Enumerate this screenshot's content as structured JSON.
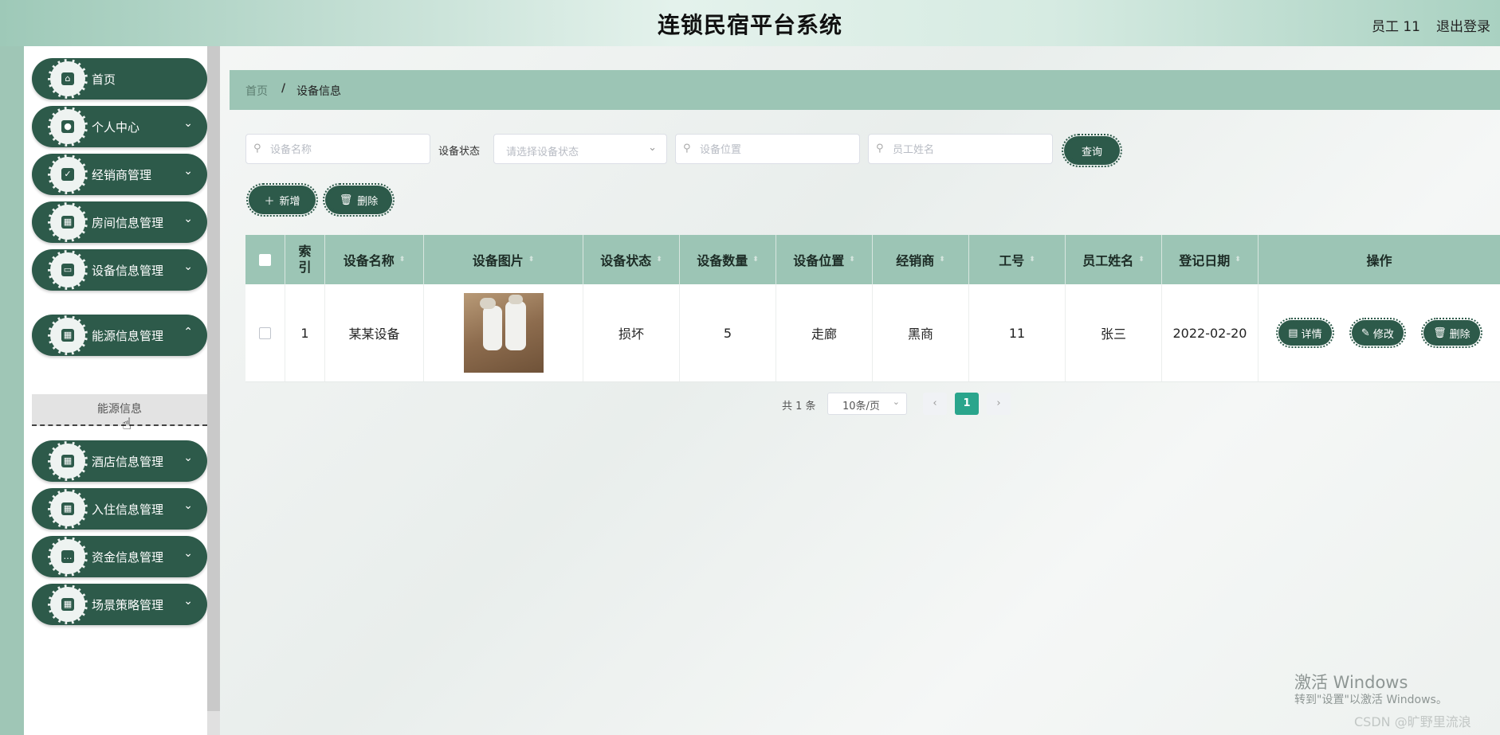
{
  "header": {
    "title": "连锁民宿平台系统",
    "user": "员工 11",
    "logout": "退出登录"
  },
  "sidebar": {
    "items": [
      {
        "label": "首页",
        "icon": "home-icon",
        "has_chevron": false
      },
      {
        "label": "个人中心",
        "icon": "user-icon",
        "has_chevron": true
      },
      {
        "label": "经销商管理",
        "icon": "clipboard-icon",
        "has_chevron": true
      },
      {
        "label": "房间信息管理",
        "icon": "grid-icon",
        "has_chevron": true
      },
      {
        "label": "设备信息管理",
        "icon": "device-icon",
        "has_chevron": true
      },
      {
        "label": "能源信息管理",
        "icon": "grid-icon",
        "has_chevron": true
      },
      {
        "label": "酒店信息管理",
        "icon": "grid-icon",
        "has_chevron": true
      },
      {
        "label": "入住信息管理",
        "icon": "grid-icon",
        "has_chevron": true
      },
      {
        "label": "资金信息管理",
        "icon": "chat-icon",
        "has_chevron": true
      },
      {
        "label": "场景策略管理",
        "icon": "grid-icon",
        "has_chevron": true
      }
    ],
    "submenu": {
      "label": "能源信息"
    }
  },
  "breadcrumb": {
    "home": "首页",
    "separator": "/",
    "current": "设备信息"
  },
  "search": {
    "name_placeholder": "设备名称",
    "status_label": "设备状态",
    "status_placeholder": "请选择设备状态",
    "location_placeholder": "设备位置",
    "employee_placeholder": "员工姓名",
    "query_label": "查询"
  },
  "toolbar": {
    "add_label": "新增",
    "delete_label": "删除"
  },
  "table": {
    "columns": [
      "索引",
      "设备名称",
      "设备图片",
      "设备状态",
      "设备数量",
      "设备位置",
      "经销商",
      "工号",
      "员工姓名",
      "登记日期",
      "操作"
    ],
    "rows": [
      {
        "index": "1",
        "name": "某某设备",
        "status": "损坏",
        "quantity": "5",
        "location": "走廊",
        "dealer": "黑商",
        "employee_no": "11",
        "employee_name": "张三",
        "date": "2022-02-20",
        "actions": {
          "detail": "详情",
          "edit": "修改",
          "delete": "删除"
        }
      }
    ]
  },
  "pagination": {
    "total": "共 1 条",
    "page_size": "10条/页",
    "current_page": "1"
  },
  "watermark": {
    "line1": "激活 Windows",
    "line2": "转到\"设置\"以激活 Windows。",
    "csdn": "CSDN @旷野里流浪"
  },
  "colors": {
    "primary": "#2d5a4a",
    "header_bg": "#9cc5b5",
    "page_active": "#2aa58c"
  }
}
